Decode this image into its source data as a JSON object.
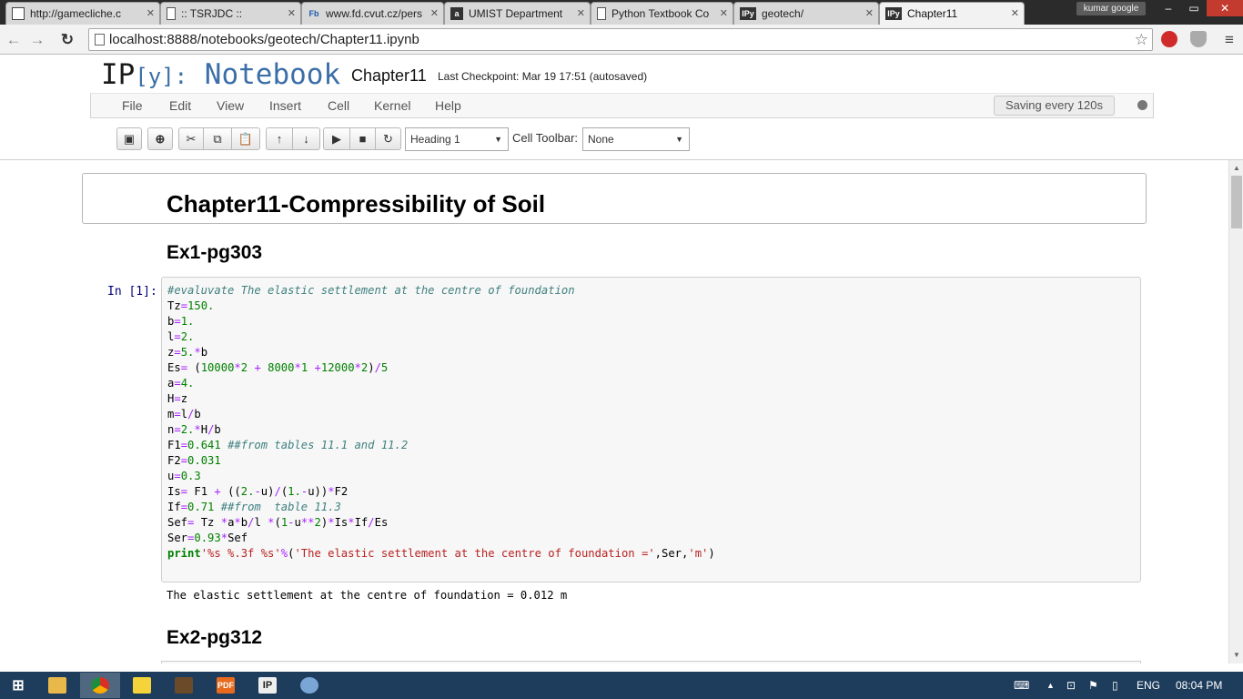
{
  "browser": {
    "tabs": [
      {
        "label": "http://gamecliche.c",
        "icon": "device-icon",
        "active": false
      },
      {
        "label": ":: TSRJDC ::",
        "icon": "page-icon",
        "active": false
      },
      {
        "label": "www.fd.cvut.cz/pers",
        "icon": "fd-icon",
        "active": false
      },
      {
        "label": "UMIST Department",
        "icon": "a-icon",
        "active": false
      },
      {
        "label": "Python Textbook Co",
        "icon": "page-icon",
        "active": false
      },
      {
        "label": "geotech/",
        "icon": "ipy-icon",
        "active": false
      },
      {
        "label": "Chapter11",
        "icon": "ipy-icon",
        "active": true
      }
    ],
    "profile_name": "kumar google",
    "url": "localhost:8888/notebooks/geotech/Chapter11.ipynb",
    "window_controls": {
      "minimize": "–",
      "maximize": "▭",
      "close": "✕"
    }
  },
  "notebook": {
    "logo": {
      "ip": "IP",
      "y": "[y]:",
      "notebook": "Notebook"
    },
    "name": "Chapter11",
    "checkpoint": "Last Checkpoint: Mar 19 17:51 (autosaved)",
    "menu": [
      "File",
      "Edit",
      "View",
      "Insert",
      "Cell",
      "Kernel",
      "Help"
    ],
    "saving_status": "Saving every 120s",
    "toolbar": {
      "buttons": [
        "save-icon",
        "insert-cell-icon",
        "cut-icon",
        "copy-icon",
        "paste-icon",
        "move-up-icon",
        "move-down-icon",
        "run-icon",
        "stop-icon",
        "restart-icon"
      ],
      "cell_type": "Heading 1",
      "cell_toolbar_label": "Cell Toolbar:",
      "cell_toolbar_value": "None"
    },
    "cells": {
      "heading1": "Chapter11-Compressibility of Soil",
      "heading2a": "Ex1-pg303",
      "prompt": "In [1]:",
      "output": "The elastic settlement at the centre of foundation = 0.012 m",
      "heading2b": "Ex2-pg312"
    }
  },
  "taskbar": {
    "apps": [
      "windows-start-icon",
      "file-explorer-icon",
      "chrome-icon",
      "sticky-notes-icon",
      "media-icon",
      "pdf-icon",
      "ipython-icon",
      "paint-icon"
    ],
    "language": "ENG",
    "time": "08:04 PM"
  },
  "colors": {
    "accent": "#3b6fa7",
    "prompt": "#000080",
    "taskbar": "#1e3d5c"
  }
}
